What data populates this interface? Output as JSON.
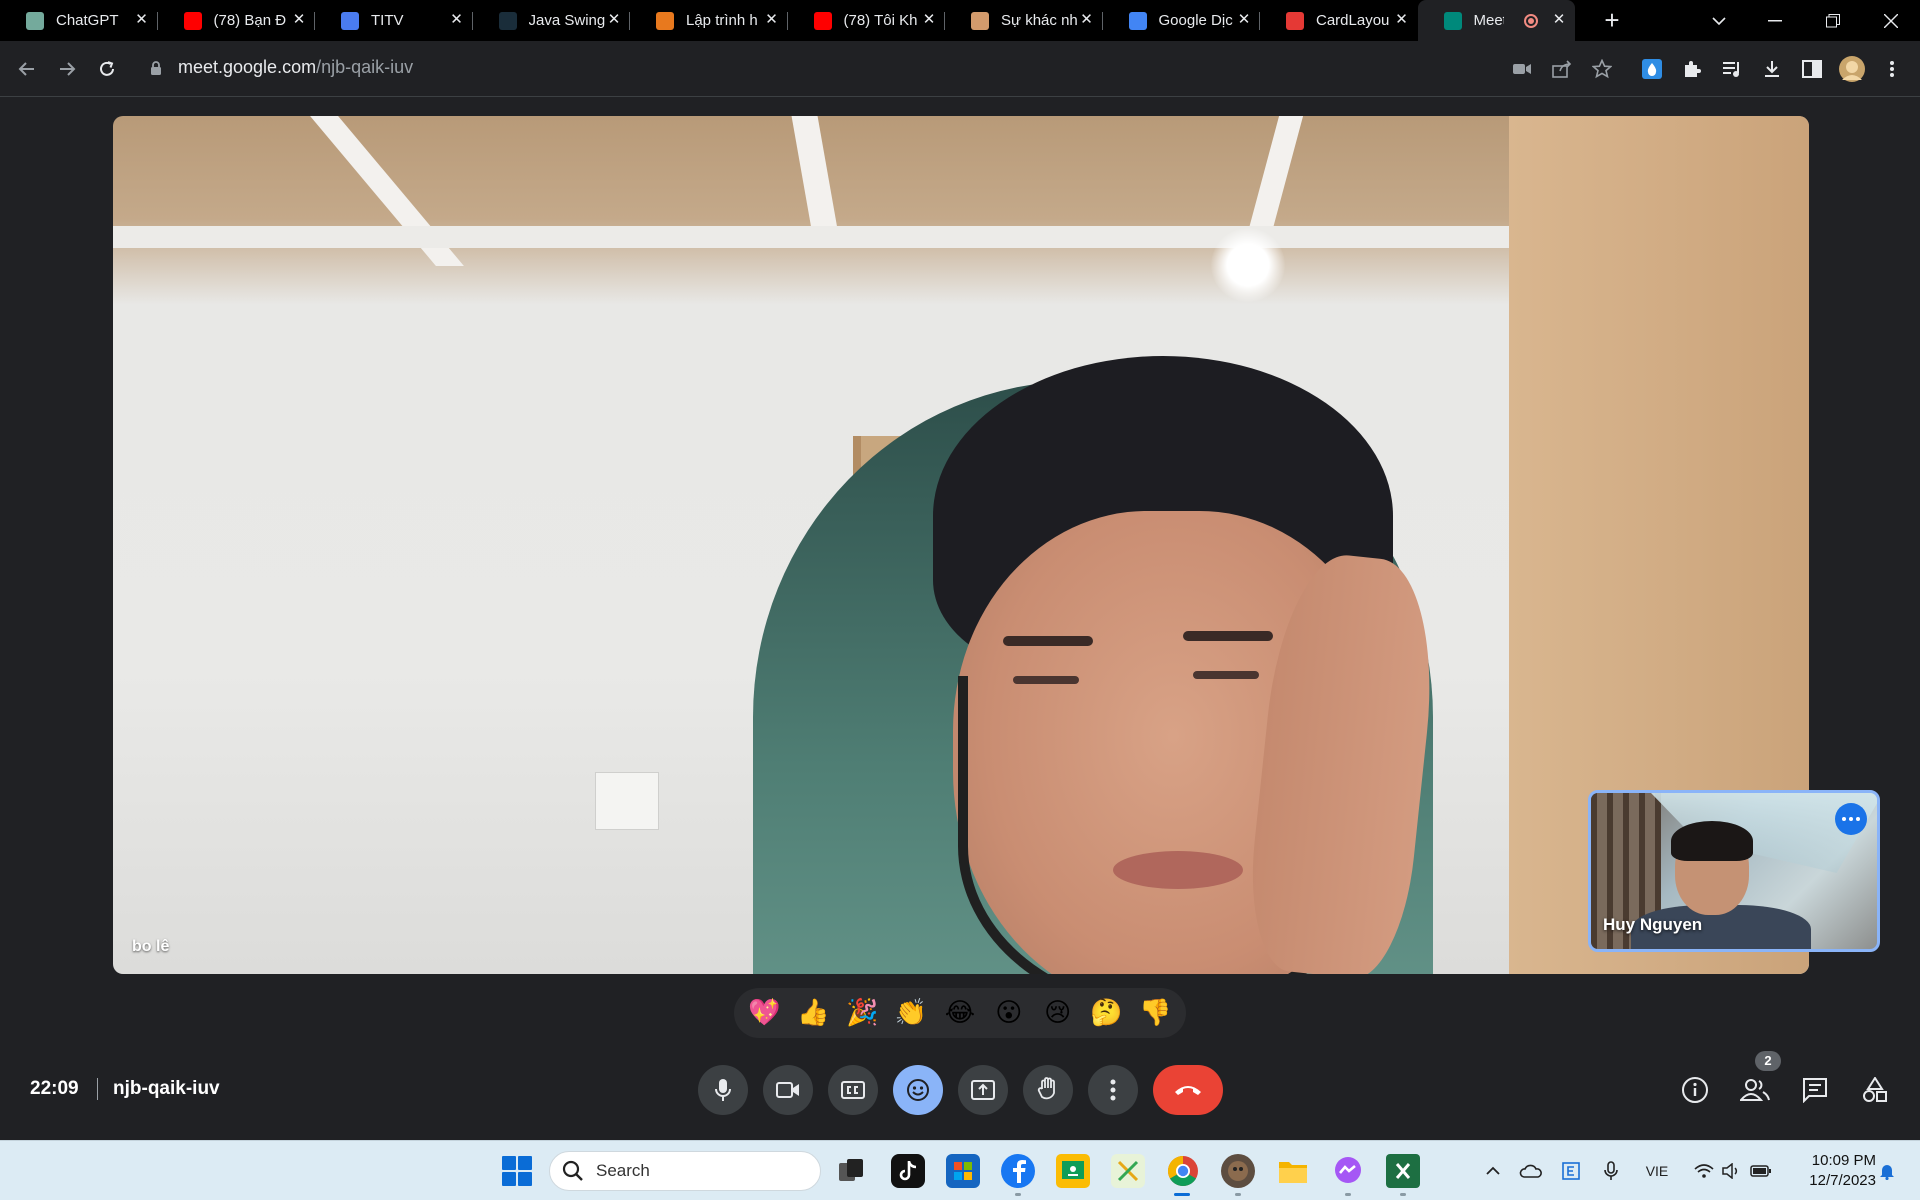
{
  "browser": {
    "tabs": [
      {
        "title": "ChatGPT",
        "icon": "chatgpt-icon",
        "color": "#74aa9c"
      },
      {
        "title": "(78) Bạn Đ",
        "icon": "youtube-icon",
        "color": "#ff0000"
      },
      {
        "title": "TITV",
        "icon": "titv-icon",
        "color": "#4a7cf0"
      },
      {
        "title": "Java Swing",
        "icon": "java-icon",
        "color": "#1a2d3a"
      },
      {
        "title": "Lập trình h",
        "icon": "tm-icon",
        "color": "#e8791e"
      },
      {
        "title": "(78) Tôi Kh",
        "icon": "youtube-icon",
        "color": "#ff0000"
      },
      {
        "title": "Sự khác nh",
        "icon": "avatar-icon",
        "color": "#d29a6c"
      },
      {
        "title": "Google Dịc",
        "icon": "google-translate-icon",
        "color": "#4285f4"
      },
      {
        "title": "CardLayou",
        "icon": "t-logo-icon",
        "color": "#e53935"
      },
      {
        "title": "Meet -",
        "icon": "google-meet-icon",
        "color": "#00897b",
        "active": true
      }
    ],
    "close_glyph": "✕",
    "new_tab_glyph": "+",
    "url_host": "meet.google.com",
    "url_path": "/njb-qaik-iuv"
  },
  "meet": {
    "main_participant": "bo lê",
    "self_view_name": "Huy Nguyen",
    "reactions": [
      "💖",
      "👍",
      "🎉",
      "👏",
      "😂",
      "😮",
      "😢",
      "🤔",
      "👎"
    ],
    "time": "22:09",
    "meeting_code": "njb-qaik-iuv",
    "participant_count": "2",
    "accent_color": "#8ab4f8",
    "end_call_color": "#ea4335"
  },
  "taskbar": {
    "search_label": "Search",
    "language": "VIE",
    "clock_time": "10:09 PM",
    "clock_date": "12/7/2023"
  }
}
